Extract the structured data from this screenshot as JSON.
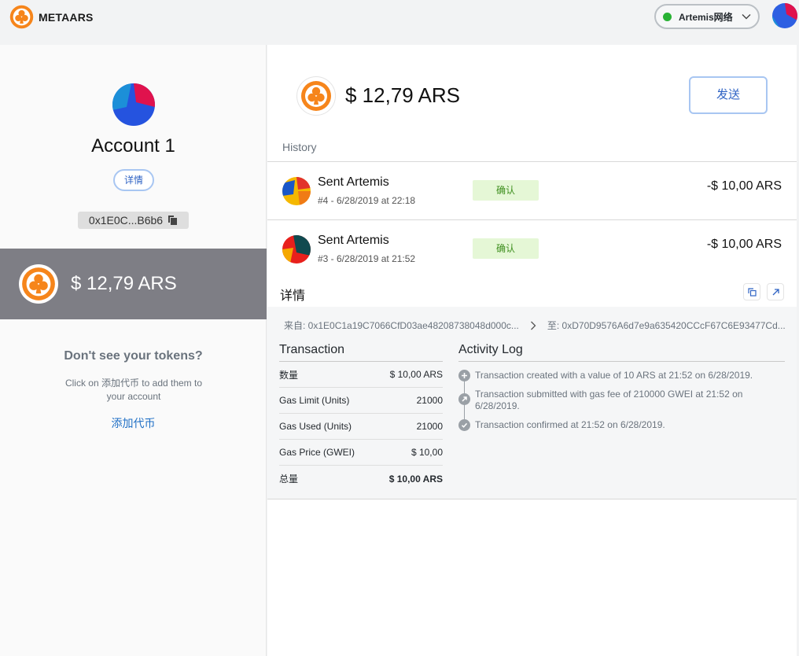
{
  "app": {
    "brand": "METAARS"
  },
  "network": {
    "label": "Artemis网络",
    "status_color": "#29b234"
  },
  "account": {
    "name": "Account 1",
    "details_label": "详情",
    "address_short": "0x1E0C...B6b6",
    "balance": "$ 12,79 ARS"
  },
  "tokens_prompt": {
    "title": "Don't see your tokens?",
    "subtitle": "Click on 添加代币 to add them to your account",
    "add_link": "添加代币"
  },
  "main": {
    "balance": "$ 12,79 ARS",
    "send_label": "发送",
    "history_label": "History"
  },
  "transactions": [
    {
      "title": "Sent Artemis",
      "subtitle": "#4 - 6/28/2019 at 22:18",
      "status": "确认",
      "amount": "-$ 10,00 ARS"
    },
    {
      "title": "Sent Artemis",
      "subtitle": "#3 - 6/28/2019 at 21:52",
      "status": "确认",
      "amount": "-$ 10,00 ARS"
    }
  ],
  "details": {
    "title": "详情",
    "from": "来自: 0x1E0C1a19C7066CfD03ae48208738048d000c...",
    "to": "至: 0xD70D9576A6d7e9a635420CCcF67C6E93477Cd...",
    "transaction_title": "Transaction",
    "rows": [
      {
        "label": "数量",
        "value": "$ 10,00 ARS"
      },
      {
        "label": "Gas Limit (Units)",
        "value": "21000"
      },
      {
        "label": "Gas Used (Units)",
        "value": "21000"
      },
      {
        "label": "Gas Price (GWEI)",
        "value": "$ 10,00"
      },
      {
        "label": "总量",
        "value": "$ 10,00 ARS"
      }
    ],
    "activity_title": "Activity Log",
    "activity": [
      {
        "icon": "plus-icon",
        "text": "Transaction created with a value of 10 ARS at 21:52 on 6/28/2019."
      },
      {
        "icon": "arrow-up-right-icon",
        "text": "Transaction submitted with gas fee of 210000 GWEI at 21:52 on 6/28/2019."
      },
      {
        "icon": "check-icon",
        "text": "Transaction confirmed at 21:52 on 6/28/2019."
      }
    ]
  },
  "colors": {
    "accent": "#f6851b",
    "link": "#1f6fc5",
    "status_bg": "#e5f7d6",
    "status_text": "#3e8f1e",
    "balance_bar": "#7e7e85"
  }
}
